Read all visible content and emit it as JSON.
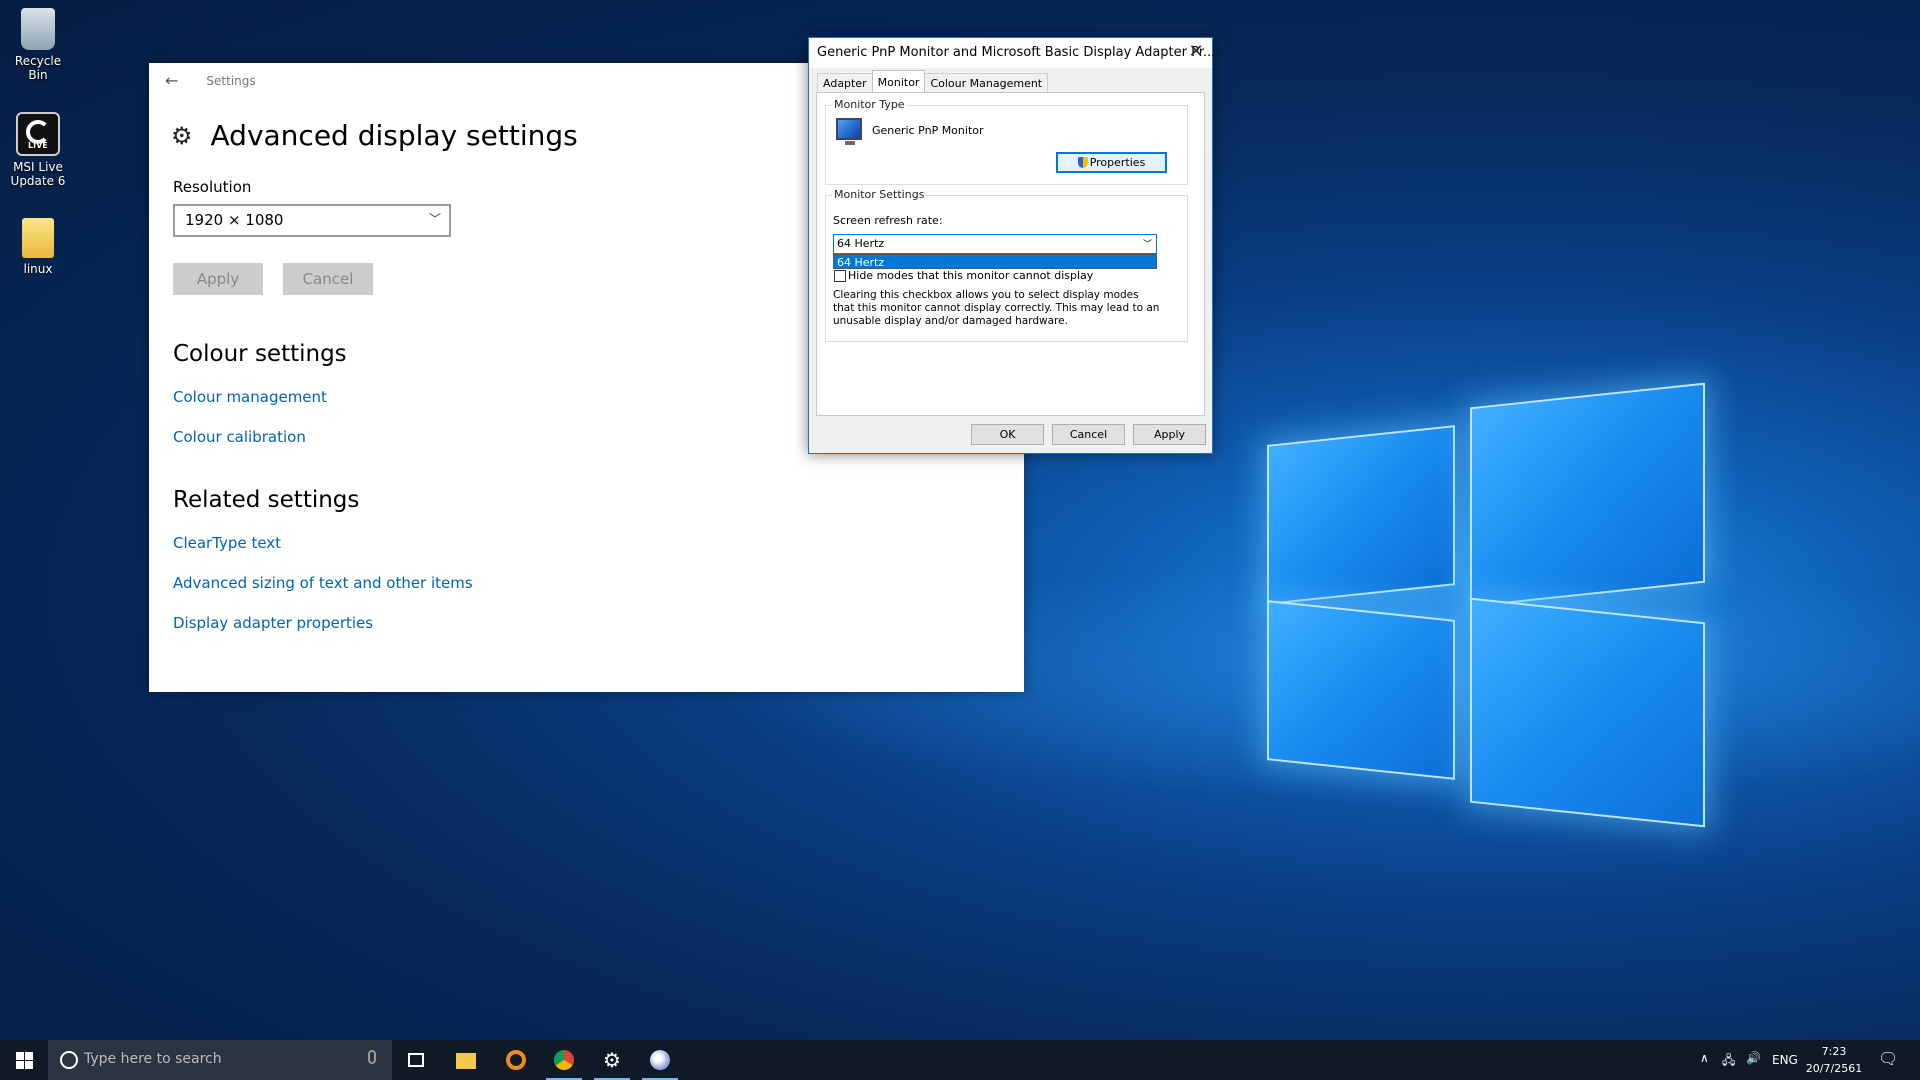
{
  "desktop": {
    "icons": [
      {
        "label": "Recycle Bin"
      },
      {
        "label": "MSI Live Update 6"
      },
      {
        "label": "linux"
      }
    ]
  },
  "settings": {
    "breadcrumb": "Settings",
    "title": "Advanced display settings",
    "resolution_label": "Resolution",
    "resolution_value": "1920 × 1080",
    "apply_label": "Apply",
    "cancel_label": "Cancel",
    "colour_heading": "Colour settings",
    "colour_links": [
      "Colour management",
      "Colour calibration"
    ],
    "related_heading": "Related settings",
    "related_links": [
      "ClearType text",
      "Advanced sizing of text and other items",
      "Display adapter properties"
    ]
  },
  "dialog": {
    "title": "Generic PnP Monitor and Microsoft Basic Display Adapter Pr...",
    "tabs": [
      "Adapter",
      "Monitor",
      "Colour Management"
    ],
    "active_tab": "Monitor",
    "monitor_type_legend": "Monitor Type",
    "monitor_name": "Generic PnP Monitor",
    "properties_label": "Properties",
    "monitor_settings_legend": "Monitor Settings",
    "refresh_label": "Screen refresh rate:",
    "refresh_value": "64 Hertz",
    "refresh_options": [
      "64 Hertz"
    ],
    "hide_modes_label": "Hide modes that this monitor cannot display",
    "note": "Clearing this checkbox allows you to select display modes that this monitor cannot display correctly. This may lead to an unusable display and/or damaged hardware.",
    "ok_label": "OK",
    "cancel_label": "Cancel",
    "apply_label": "Apply"
  },
  "taskbar": {
    "search_placeholder": "Type here to search",
    "language": "ENG",
    "time": "7:23",
    "date": "20/7/2561"
  },
  "colors": {
    "accent": "#0078d7",
    "link": "#0063b1",
    "taskbar": "#101a26"
  }
}
